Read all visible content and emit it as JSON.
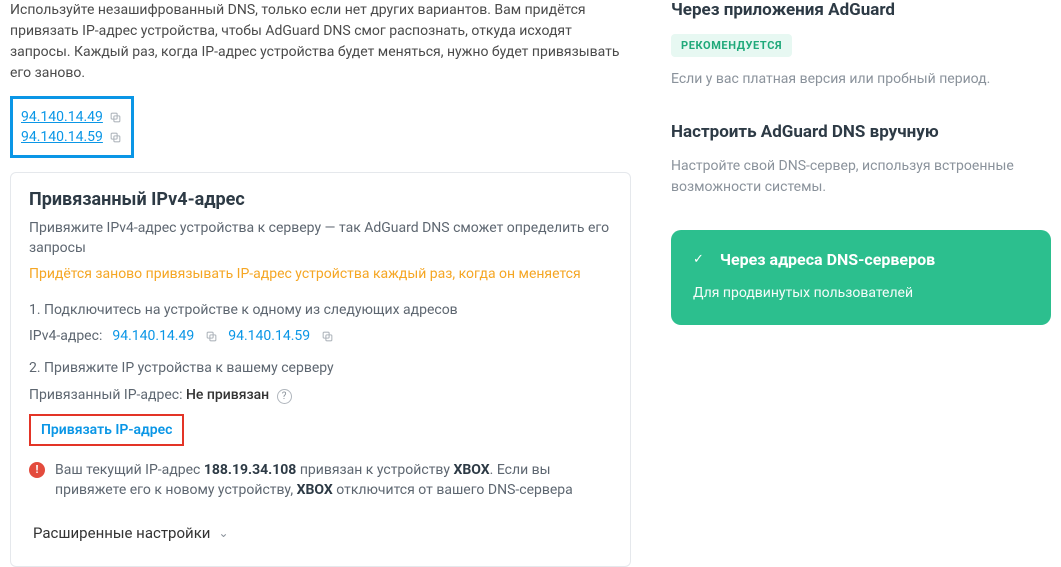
{
  "intro": "Используйте незашифрованный DNS, только если нет других вариантов. Вам придётся привязать IP-адрес устройства, чтобы AdGuard DNS смог распознать, откуда исходят запросы. Каждый раз, когда IP-адрес устройства будет меняться, нужно будет привязывать его заново.",
  "top_dns": [
    "94.140.14.49",
    "94.140.14.59"
  ],
  "card": {
    "title": "Привязанный IPv4-адрес",
    "subtitle": "Привяжите IPv4-адрес устройства к серверу — так AdGuard DNS сможет определить его запросы",
    "warning": "Придётся заново привязывать IP-адрес устройства каждый раз, когда он меняется",
    "step1": "1. Подключитесь на устройстве к одному из следующих адресов",
    "ipv4_label": "IPv4-адрес:",
    "ipv4_list": [
      "94.140.14.49",
      "94.140.14.59"
    ],
    "step2": "2. Привяжите IP устройства к вашему серверу",
    "bound_label": "Привязанный IP-адрес:",
    "bound_value": "Не привязан",
    "bind_link": "Привязать IP-адрес",
    "alert_pre": "Ваш текущий IP-адрес ",
    "alert_ip": "188.19.34.108",
    "alert_mid": " привязан к устройству ",
    "alert_device": "XBOX",
    "alert_mid2": ". Если вы привяжете его к новому устройству, ",
    "alert_device2": "XBOX",
    "alert_post": " отключится от вашего DNS-сервера",
    "advanced": "Расширенные настройки"
  },
  "side": {
    "apps_title": "Через приложения AdGuard",
    "badge": "РЕКОМЕНДУЕТСЯ",
    "apps_note": "Если у вас платная версия или пробный период.",
    "manual_title": "Настроить AdGuard DNS вручную",
    "manual_note": "Настройте свой DNS-сервер, используя встроенные возможности системы.",
    "green_title": "Через адреса DNS-серверов",
    "green_sub": "Для продвинутых пользователей"
  }
}
